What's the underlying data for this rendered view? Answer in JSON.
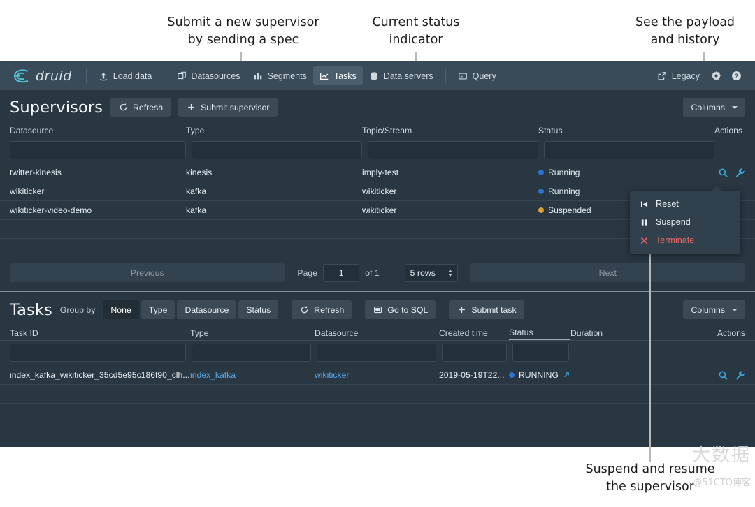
{
  "annotations": [
    {
      "id": "a1",
      "text": "Submit a new supervisor\nby sending a spec"
    },
    {
      "id": "a2",
      "text": "Current status\nindicator"
    },
    {
      "id": "a3",
      "text": "See the payload\nand history"
    },
    {
      "id": "a4",
      "text": "Suspend and resume\nthe supervisor"
    }
  ],
  "navbar": {
    "brand": "druid",
    "items": [
      {
        "label": "Load data",
        "icon": "upload-icon",
        "active": false
      },
      {
        "label": "Datasources",
        "icon": "datasources-icon",
        "active": false
      },
      {
        "label": "Segments",
        "icon": "segments-icon",
        "active": false
      },
      {
        "label": "Tasks",
        "icon": "tasks-icon",
        "active": true
      },
      {
        "label": "Data servers",
        "icon": "server-icon",
        "active": false
      },
      {
        "label": "Query",
        "icon": "query-icon",
        "active": false
      }
    ],
    "legacy": "Legacy",
    "legacy_icon": "external-link-icon",
    "settings_icon": "gear-icon",
    "help_icon": "help-icon"
  },
  "supervisors": {
    "title": "Supervisors",
    "refresh_label": "Refresh",
    "refresh_icon": "refresh-icon",
    "submit_label": "Submit supervisor",
    "submit_icon": "plus-icon",
    "columns_label": "Columns",
    "headers": [
      "Datasource",
      "Type",
      "Topic/Stream",
      "Status",
      "Actions"
    ],
    "rows": [
      {
        "datasource": "twitter-kinesis",
        "type": "kinesis",
        "topic": "imply-test",
        "status": "Running",
        "status_color": "#2d72d2"
      },
      {
        "datasource": "wikiticker",
        "type": "kafka",
        "topic": "wikiticker",
        "status": "Running",
        "status_color": "#2d72d2"
      },
      {
        "datasource": "wikiticker-video-demo",
        "type": "kafka",
        "topic": "wikiticker",
        "status": "Suspended",
        "status_color": "#e0a02f"
      }
    ],
    "action_icons": [
      "magnifier-icon",
      "wrench-icon"
    ],
    "pagination": {
      "previous": "Previous",
      "page_label": "Page",
      "page_value": "1",
      "of_label": "of 1",
      "rows_value": "5 rows",
      "next": "Next"
    }
  },
  "context_menu": {
    "items": [
      {
        "label": "Reset",
        "icon": "skip-back-icon",
        "danger": false
      },
      {
        "label": "Suspend",
        "icon": "pause-icon",
        "danger": false
      },
      {
        "label": "Terminate",
        "icon": "cross-icon",
        "danger": true
      }
    ]
  },
  "tasks": {
    "title": "Tasks",
    "group_by_label": "Group by",
    "group_by_options": [
      {
        "label": "None",
        "selected": true
      },
      {
        "label": "Type",
        "selected": false
      },
      {
        "label": "Datasource",
        "selected": false
      },
      {
        "label": "Status",
        "selected": false
      }
    ],
    "refresh_label": "Refresh",
    "refresh_icon": "refresh-icon",
    "go_to_sql_label": "Go to SQL",
    "go_to_sql_icon": "console-icon",
    "submit_task_label": "Submit task",
    "submit_task_icon": "plus-icon",
    "columns_label": "Columns",
    "headers": [
      "Task ID",
      "Type",
      "Datasource",
      "Created time",
      "Status",
      "Duration",
      "Actions"
    ],
    "sorted_header": "Status",
    "rows": [
      {
        "task_id": "index_kafka_wikiticker_35cd5e95c186f90_clh...",
        "type": "index_kafka",
        "datasource": "wikiticker",
        "created_time": "2019-05-19T22...",
        "status": "RUNNING",
        "status_color": "#2d72d2",
        "duration": ""
      }
    ],
    "action_icons": [
      "magnifier-icon",
      "wrench-icon"
    ]
  },
  "watermark": {
    "line1": "大数据",
    "line2": "@51CTO博客"
  }
}
